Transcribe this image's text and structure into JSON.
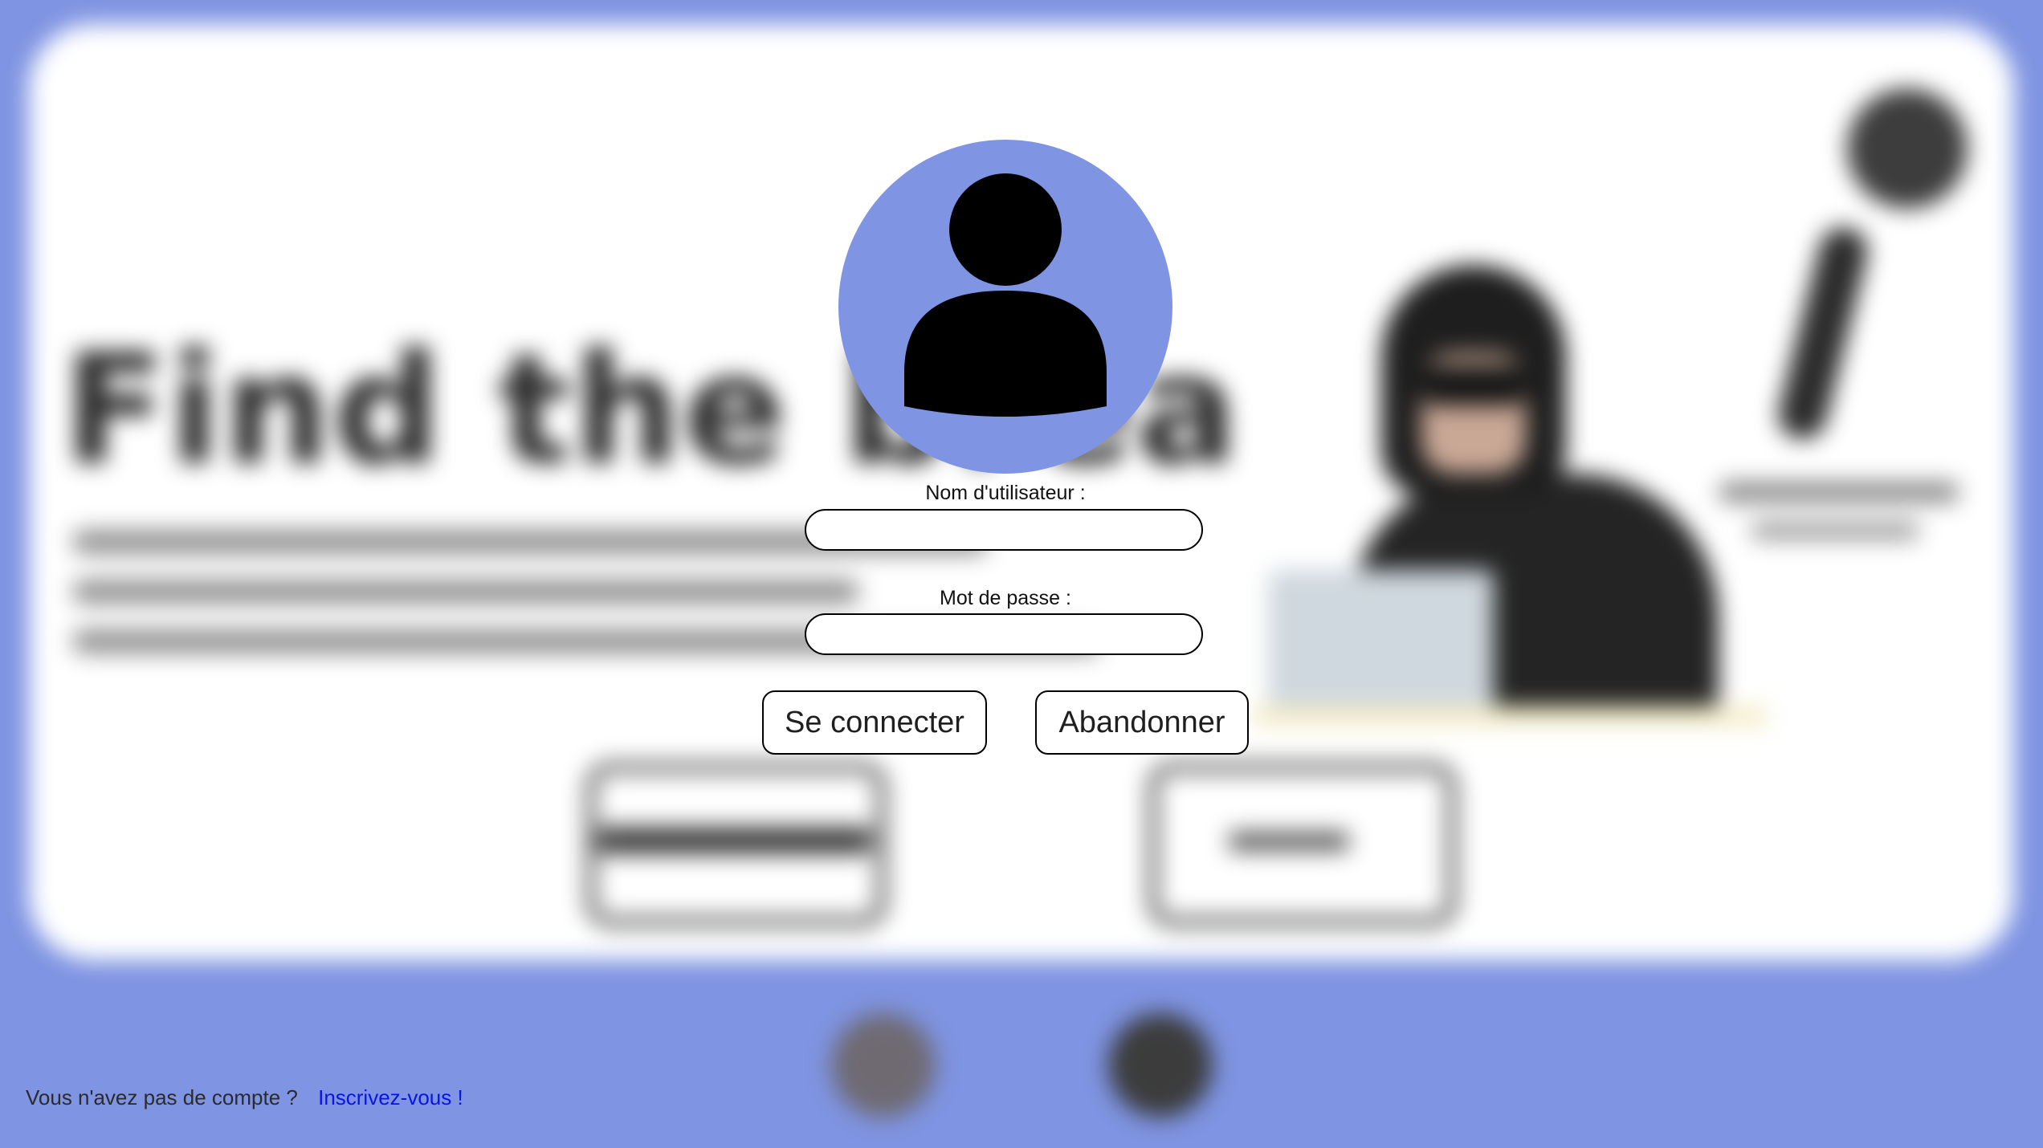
{
  "background": {
    "headline": "Find the brea",
    "accent_color": "#7f94e2",
    "blurred": true
  },
  "login": {
    "avatar_icon": "user-avatar-icon",
    "username_label": "Nom d'utilisateur :",
    "username_value": "",
    "password_label": "Mot de passe :",
    "password_value": "",
    "login_button": "Se connecter",
    "cancel_button": "Abandonner"
  },
  "footer": {
    "signup_prompt": "Vous n'avez pas de compte ?",
    "signup_link": "Inscrivez-vous !",
    "link_color": "#0a14e6"
  }
}
